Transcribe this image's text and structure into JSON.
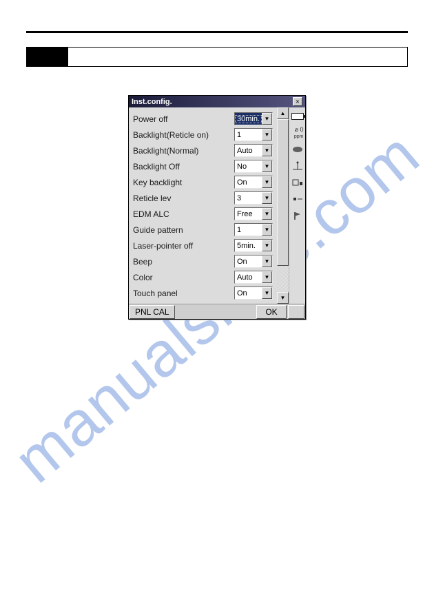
{
  "watermark": "manualshive.com",
  "dialog": {
    "title": "Inst.config.",
    "settings": [
      {
        "label": "Power off",
        "value": "30min.",
        "selected": true
      },
      {
        "label": "Backlight(Reticle on)",
        "value": "1"
      },
      {
        "label": "Backlight(Normal)",
        "value": "Auto"
      },
      {
        "label": "Backlight Off",
        "value": "No"
      },
      {
        "label": "Key backlight",
        "value": "On"
      },
      {
        "label": "Reticle lev",
        "value": "3"
      },
      {
        "label": "EDM ALC",
        "value": "Free"
      },
      {
        "label": "Guide pattern",
        "value": "1"
      },
      {
        "label": "Laser-pointer off",
        "value": "5min."
      },
      {
        "label": "Beep",
        "value": "On"
      },
      {
        "label": "Color",
        "value": "Auto"
      },
      {
        "label": "Touch panel",
        "value": "On"
      }
    ],
    "buttons": {
      "pnl_cal": "PNL CAL",
      "ok": "OK"
    },
    "status": {
      "ppm_value": "0",
      "ppm_unit": "ppm"
    }
  }
}
